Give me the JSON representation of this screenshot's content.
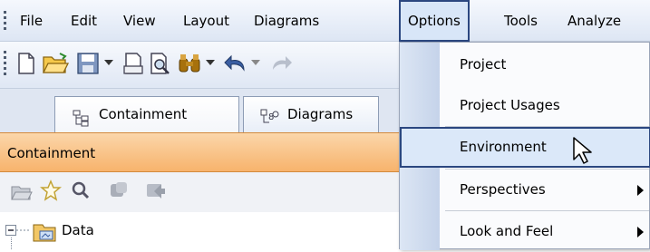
{
  "menubar": {
    "items": [
      "File",
      "Edit",
      "View",
      "Layout",
      "Diagrams",
      "Options",
      "Tools",
      "Analyze"
    ],
    "active": "Options"
  },
  "tabs": [
    {
      "label": "Containment",
      "icon": "containment-tree-icon"
    },
    {
      "label": "Diagrams",
      "icon": "diagrams-icon"
    }
  ],
  "panel": {
    "title": "Containment"
  },
  "tree": {
    "root_label": "Data"
  },
  "options_menu": {
    "items": [
      {
        "label": "Project",
        "submenu": false
      },
      {
        "label": "Project Usages",
        "submenu": false
      },
      {
        "label": "Environment",
        "submenu": false,
        "highlighted": true
      },
      {
        "label": "Perspectives",
        "submenu": true
      },
      {
        "label": "Look and Feel",
        "submenu": true
      }
    ]
  },
  "colors": {
    "accent_border": "#2b4780",
    "panel_header": "#f7b36c",
    "menu_highlight": "#dbe8f9"
  }
}
